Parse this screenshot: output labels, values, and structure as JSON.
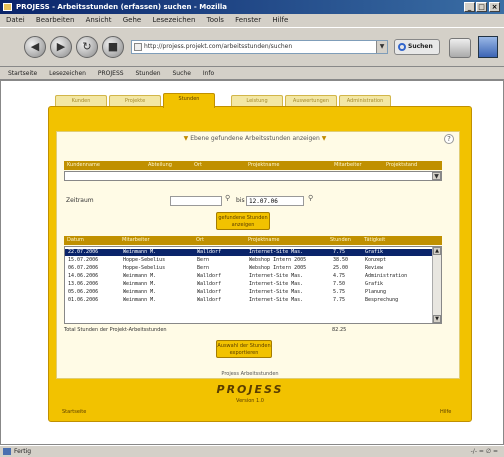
{
  "window": {
    "title": "PROJESS - Arbeitsstunden (erfassen) suchen - Mozilla",
    "controls": [
      "_",
      "□",
      "×"
    ]
  },
  "menubar": [
    "Datei",
    "Bearbeiten",
    "Ansicht",
    "Gehe",
    "Lesezeichen",
    "Tools",
    "Fenster",
    "Hilfe"
  ],
  "navbar": {
    "back": "◀",
    "forward": "▶",
    "reload": "↻",
    "stop": "■",
    "url": "http://projess.projekt.com/arbeitsstunden/suchen",
    "search_label": "Suchen"
  },
  "linksbar": [
    "Startseite",
    "Lesezeichen",
    "PROJESS",
    "Stunden",
    "Suche",
    "Info"
  ],
  "tabs": [
    "Kunden",
    "Projekte",
    "Stunden",
    "Leistung",
    "Auswertungen",
    "Administration"
  ],
  "active_tab": 2,
  "filter": {
    "link_text": "Ebene gefundene Arbeitsstunden anzeigen",
    "columns": [
      "Kundenname",
      "Abteilung",
      "Ort",
      "Projektname",
      "Mitarbeiter",
      "Projektstand"
    ],
    "date_label": "Zeitraum",
    "date_from": "",
    "date_to_label": "bis",
    "date_to": "12.07.06",
    "search_button": "gefundene Stunden anzeigen"
  },
  "results": {
    "columns": [
      "Datum",
      "Mitarbeiter",
      "Ort",
      "Projektname",
      "Stunden",
      "Tätigkeit"
    ],
    "rows": [
      {
        "date": "22.07.2006",
        "employee": "Weinmann M.",
        "place": "Walldorf",
        "project": "Internet-Site Mas.",
        "hours": "7.75",
        "task": "Grafik"
      },
      {
        "date": "15.07.2006",
        "employee": "Hoppe-Sebelius",
        "place": "Bern",
        "project": "Webshop Intern 2005",
        "hours": "38.50",
        "task": "Konzept"
      },
      {
        "date": "06.07.2006",
        "employee": "Hoppe-Sebelius",
        "place": "Bern",
        "project": "Webshop Intern 2005",
        "hours": "25.00",
        "task": "Review"
      },
      {
        "date": "14.06.2006",
        "employee": "Weinmann M.",
        "place": "Walldorf",
        "project": "Internet-Site Mas.",
        "hours": "4.75",
        "task": "Administration"
      },
      {
        "date": "13.06.2006",
        "employee": "Weinmann M.",
        "place": "Walldorf",
        "project": "Internet-Site Mas.",
        "hours": "7.50",
        "task": "Grafik"
      },
      {
        "date": "05.06.2006",
        "employee": "Weinmann M.",
        "place": "Walldorf",
        "project": "Internet-Site Mas.",
        "hours": "5.75",
        "task": "Planung"
      },
      {
        "date": "01.06.2006",
        "employee": "Weinmann M.",
        "place": "Walldorf",
        "project": "Internet-Site Mas.",
        "hours": "7.75",
        "task": "Besprechung"
      }
    ],
    "total_label": "Total Stunden der Projekt-Arbeitsstunden",
    "total_value": "82.25",
    "export_button": "Auswahl der Stunden exportieren"
  },
  "footer": {
    "admin_link": "Projess Arbeitsstunden",
    "logo": "PROJESS",
    "version": "Version 1.0",
    "left_link": "Startseite",
    "right_link": "Hilfe"
  },
  "statusbar": {
    "text": "Fertig",
    "right": "-/- = ∅ ="
  },
  "colors": {
    "panel": "#f2c200",
    "header": "#c09000",
    "selection": "#0a246a"
  }
}
